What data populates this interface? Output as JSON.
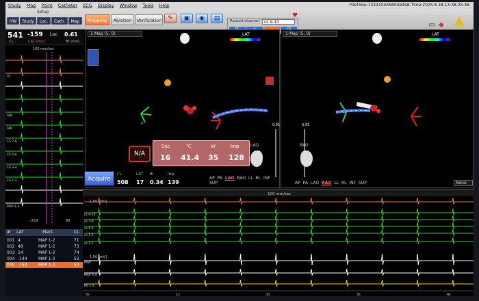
{
  "menu": [
    "Study",
    "Map",
    "Point",
    "Catheter",
    "ECG",
    "Display",
    "Window",
    "Tools",
    "Help"
  ],
  "file_time": "FileTime:1324154556049496.Time:2025.6.18.13.38.25.46",
  "toolbar": {
    "setup_label": "Setup",
    "setup_buttons": [
      "HW",
      "Study",
      "Loc.",
      "Cath.",
      "Map"
    ],
    "mapping": "Mapping",
    "ablation": "Ablation",
    "verification": "Verification",
    "routed_label": "Routed channel",
    "routed_value": "cs 9-10",
    "chips": [
      "PC",
      "+",
      "-",
      "CS"
    ]
  },
  "left": {
    "cl_value": "541",
    "cl_label": "CL",
    "lat_value": "-159",
    "lat_label": "LAT (ms)",
    "loc_label": "Loc",
    "loc_value": "0.61",
    "bi_label": "BI (mV)",
    "speed": "100 mm/sec",
    "scale_label": "-259",
    "scale_label2": "89",
    "channels": [
      "",
      "V1",
      "",
      "",
      "ABL",
      "ABL",
      "CS 7-8",
      "CS 5-6",
      "CS 3-4",
      "CS 1-2",
      "",
      "MAP 1-2"
    ]
  },
  "table": {
    "headers": [
      "#",
      "LAT",
      "Elect.",
      "CL"
    ],
    "rows": [
      {
        "id": "001",
        "lat": "4",
        "elect": "MAP 1-2",
        "cl": "71"
      },
      {
        "id": "002",
        "lat": "48",
        "elect": "MAP 1-2",
        "cl": "73"
      },
      {
        "id": "003",
        "lat": "14",
        "elect": "MAP 1-2",
        "cl": "74"
      },
      {
        "id": "004",
        "lat": "-144",
        "elect": "MAP 1-2",
        "cl": "52"
      },
      {
        "id": "005",
        "lat": "-159",
        "elect": "MAP 1-2",
        "cl": "54"
      }
    ],
    "selected": 4
  },
  "maps": {
    "left_title": "1-Map (5, 0)",
    "right_title": "1-Map (5, 0)",
    "lat_label": "LAT",
    "views_left": [
      "AP",
      "PA",
      "LAO",
      "RAO",
      "LL",
      "RL",
      "INF",
      "SUP"
    ],
    "views_right": [
      "AP",
      "PA",
      "LAO",
      "RAO",
      "LL",
      "RL",
      "INF",
      "SUP"
    ],
    "active_left": "LAO",
    "active_right": "RAO",
    "lao_label": "LAO",
    "rao_label": "RAO",
    "slider_val": "0.91",
    "slider_val2": "0.91",
    "none_label": "None",
    "r_label": "R"
  },
  "ablation": {
    "headers": [
      "Sec",
      "℃",
      "W",
      "Imp"
    ],
    "values": [
      "16",
      "41.4",
      "35",
      "128"
    ],
    "na": "N/A"
  },
  "acquire": {
    "label": "Acquire",
    "cl_label": "CL",
    "lat_label": "LAT",
    "bi_label": "Bi",
    "imp_label": "Imp",
    "cl": "508",
    "lat": "17",
    "bi": "0.34",
    "imp": "139"
  },
  "ecg": {
    "speed": "100 mm/sec",
    "time_labels": [
      "0s",
      "1s",
      "2s",
      "3s",
      "4s"
    ],
    "scale1": "1.00 [mV]",
    "scale2": "1.00 [mV]",
    "channel_labels": [
      "",
      "cs 9-10",
      "cs 7-8",
      "cs 5-6",
      "cs 3-4",
      "cs 1-2",
      "MAP",
      "MAP 3-4",
      "RV 1-2"
    ]
  },
  "colors": {
    "green": "#29d92f",
    "orange_accent": "#ee6d2a",
    "yellow": "#f0d020",
    "pink_marker": "#d040d0"
  }
}
